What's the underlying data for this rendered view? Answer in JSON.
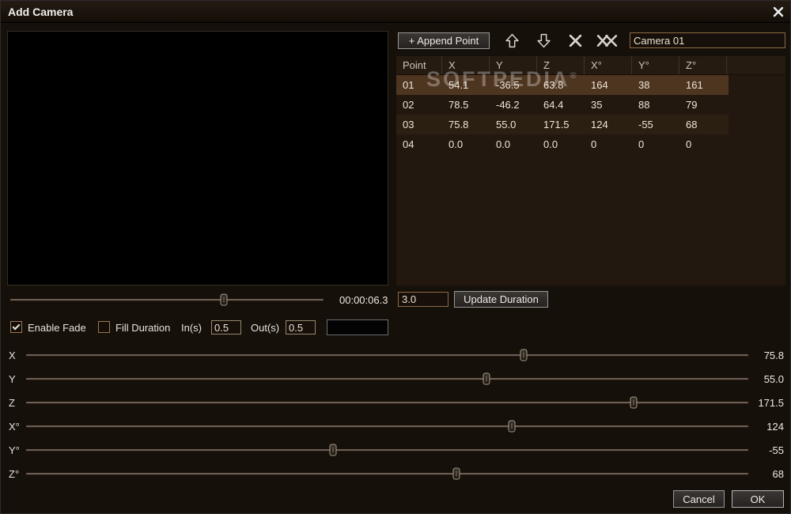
{
  "window": {
    "title": "Add Camera"
  },
  "toolbar": {
    "append_label": "+ Append Point",
    "camera_name": "Camera 01"
  },
  "table": {
    "headers": [
      "Point",
      "X",
      "Y",
      "Z",
      "X°",
      "Y°",
      "Z°"
    ],
    "rows": [
      [
        "01",
        "54.1",
        "-36.5",
        "63.8",
        "164",
        "38",
        "161"
      ],
      [
        "02",
        "78.5",
        "-46.2",
        "64.4",
        "35",
        "88",
        "79"
      ],
      [
        "03",
        "75.8",
        "55.0",
        "171.5",
        "124",
        "-55",
        "68"
      ],
      [
        "04",
        "0.0",
        "0.0",
        "0.0",
        "0",
        "0",
        "0"
      ]
    ],
    "selected_row": "01"
  },
  "watermark": {
    "text": "SOFTPEDIA",
    "reg": "®"
  },
  "duration": {
    "value": "3.0",
    "button_label": "Update Duration"
  },
  "seek": {
    "time": "00:00:06.3",
    "pct": 68.2
  },
  "fade": {
    "enable_label": "Enable Fade",
    "enable_checked": true,
    "fill_label": "Fill Duration",
    "fill_checked": false,
    "in_label": "In(s)",
    "in_value": "0.5",
    "out_label": "Out(s)",
    "out_value": "0.5",
    "color_swatch": "#000000"
  },
  "sliders": [
    {
      "label": "X",
      "value": "75.8",
      "pct": 68.9
    },
    {
      "label": "Y",
      "value": "55.0",
      "pct": 63.7
    },
    {
      "label": "Z",
      "value": "171.5",
      "pct": 84.1
    },
    {
      "label": "X°",
      "value": "124",
      "pct": 67.2
    },
    {
      "label": "Y°",
      "value": "-55",
      "pct": 42.5
    },
    {
      "label": "Z°",
      "value": "68",
      "pct": 59.6
    }
  ],
  "footer": {
    "cancel_label": "Cancel",
    "ok_label": "OK"
  },
  "colors": {
    "dialog_bg": "#16100a",
    "table_bg": "#231810",
    "selection": "#4e3520",
    "input_border": "#8d6b45"
  }
}
